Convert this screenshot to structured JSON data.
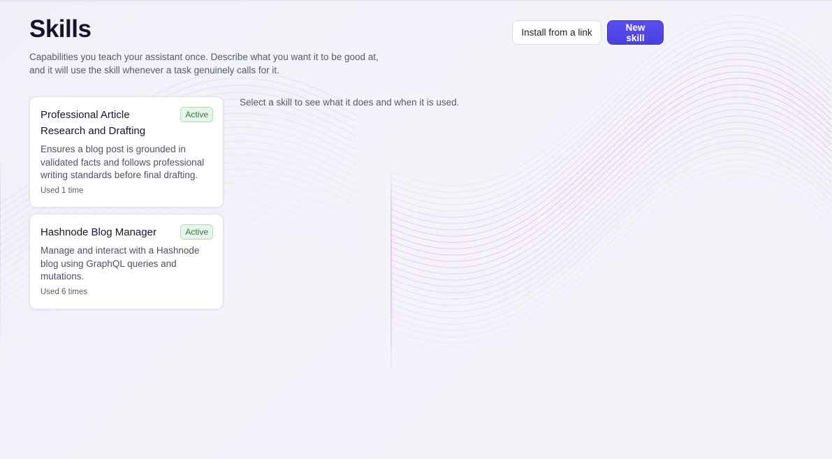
{
  "header": {
    "title": "Skills",
    "subtitle_line1": "Capabilities you teach your assistant once. Describe what you want it to be good at,",
    "subtitle_line2": "and it will use the skill whenever a task genuinely calls for it."
  },
  "actions": {
    "install_label": "Install from a link",
    "new_label": "New skill"
  },
  "skills": [
    {
      "name": "Professional Article Research and Drafting",
      "status": "Active",
      "description": "Ensures a blog post is grounded in validated facts and follows professional writing standards before final drafting.",
      "usage": "Used 1 time"
    },
    {
      "name": "Hashnode Blog Manager",
      "status": "Active",
      "description": "Manage and interact with a Hashnode blog using GraphQL queries and mutations.",
      "usage": "Used 6 times"
    }
  ],
  "detail": {
    "empty_hint": "Select a skill to see what it does and when it is used."
  },
  "colors": {
    "accent": "#4f46e5",
    "status_active_bg": "#e6f4e9",
    "status_active_text": "#2f7a41",
    "wave_right": "#d9a3e6",
    "wave_left": "#c7c6f0"
  }
}
